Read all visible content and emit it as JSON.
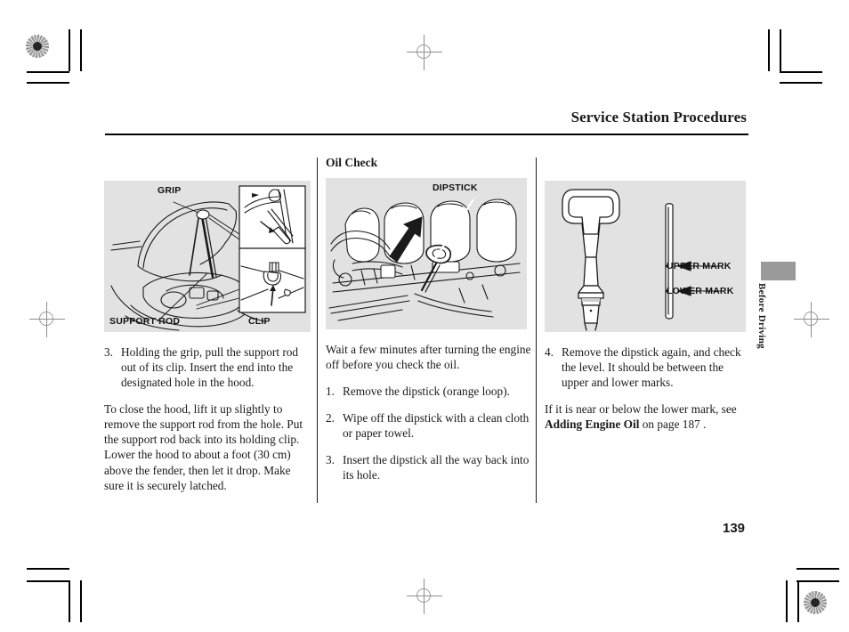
{
  "page": {
    "running_head": "Service Station Procedures",
    "folio": "139",
    "thumb_tab": "Before Driving",
    "panel_bg": "#e2e2e2",
    "tab_marker_color": "#9a9a9a"
  },
  "columns": {
    "left": {
      "figure": {
        "labels": {
          "grip": "GRIP",
          "support_rod": "SUPPORT ROD",
          "clip": "CLIP"
        }
      },
      "steps": [
        {
          "num": "3.",
          "text": "Holding the grip, pull the support rod out of its clip. Insert the end into the designated hole in the hood."
        }
      ],
      "paragraph": "To close the hood, lift it up slightly to remove the support rod from the hole. Put the support rod back into its holding clip. Lower the hood to about a foot (30 cm) above the fender, then let it drop. Make sure it is securely latched."
    },
    "middle": {
      "title": "Oil Check",
      "figure": {
        "labels": {
          "dipstick": "DIPSTICK"
        }
      },
      "intro": "Wait a few minutes after turning the engine off before you check the oil.",
      "steps": [
        {
          "num": "1.",
          "text": "Remove the dipstick (orange loop)."
        },
        {
          "num": "2.",
          "text": "Wipe off the dipstick with a clean cloth or paper towel."
        },
        {
          "num": "3.",
          "text": "Insert the dipstick all the way back into its hole."
        }
      ]
    },
    "right": {
      "figure": {
        "labels": {
          "upper_mark": "UPPER MARK",
          "lower_mark": "LOWER MARK"
        }
      },
      "steps": [
        {
          "num": "4.",
          "text": "Remove the dipstick again, and check the level. It should be between the upper and lower marks."
        }
      ],
      "crossref": {
        "lead": "If it is near or below the lower mark, see ",
        "bold": "Adding Engine Oil",
        "tail": " on page 187 ."
      }
    }
  }
}
